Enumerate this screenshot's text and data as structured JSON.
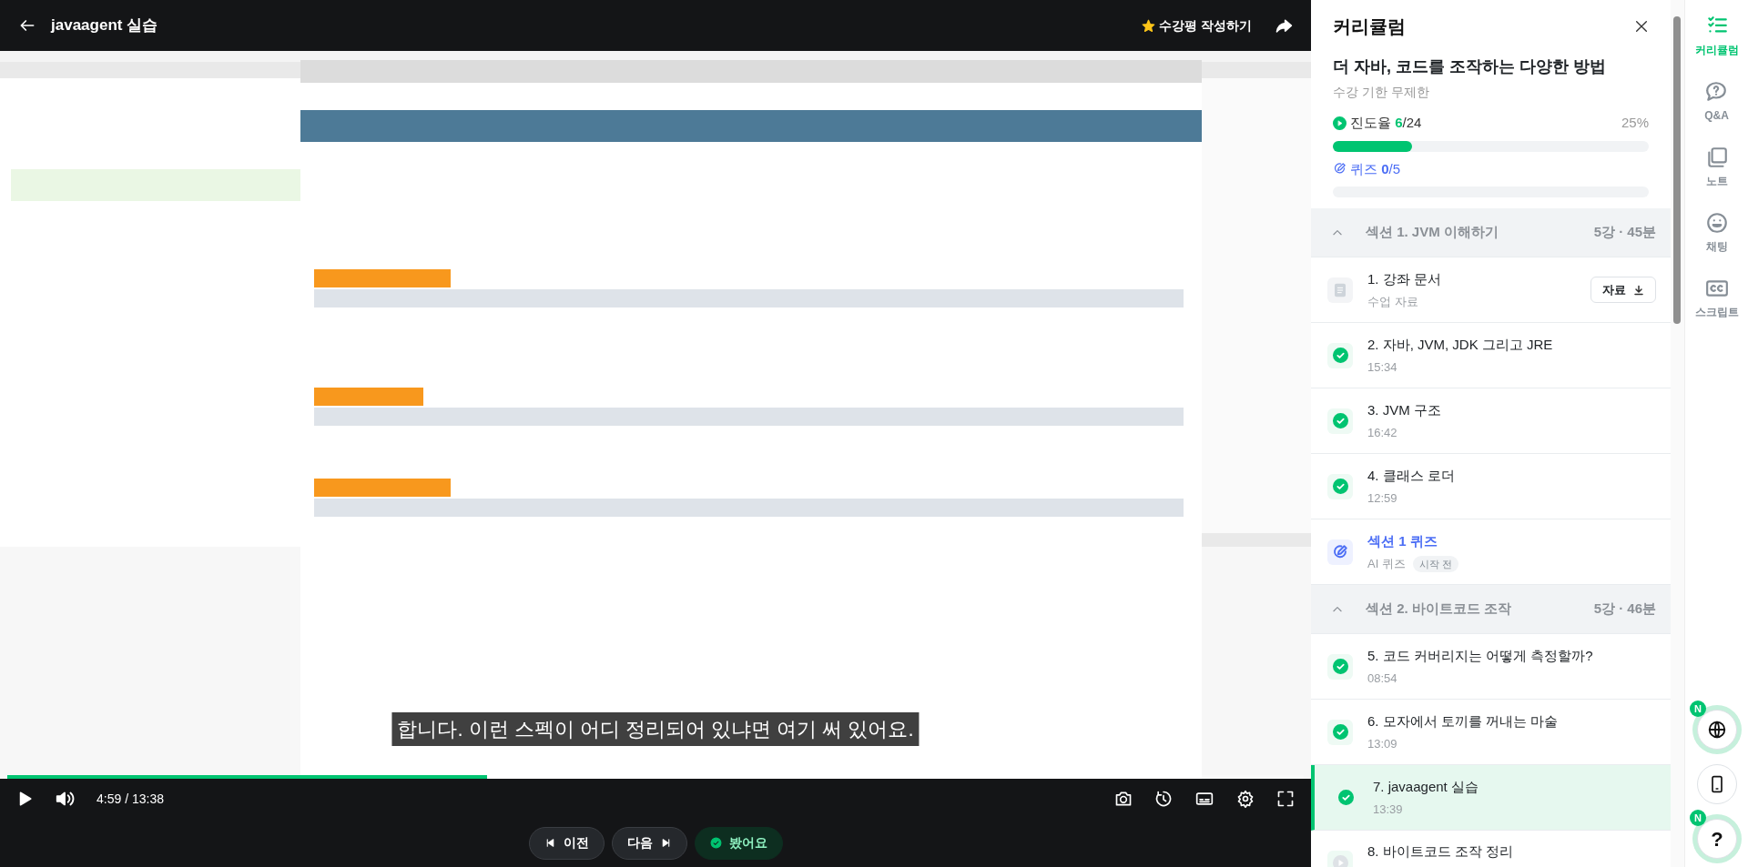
{
  "header": {
    "title": "javaagent 실습",
    "review_button": "수강평 작성하기"
  },
  "video": {
    "kind": "picture",
    "caption": "합니다. 이런 스펙이 어디 정리되어 있냐면 여기 써 있어요.",
    "level": 0.37
  },
  "controls": {
    "time": "4:59 / 13:38"
  },
  "nav_buttons": [
    {
      "kind": "prev",
      "label": "이전"
    },
    {
      "kind": "next",
      "label": "다음"
    },
    {
      "kind": "watched",
      "label": "봤어요"
    }
  ],
  "curriculum": {
    "title": "커리큘럼",
    "course_title": "더 자바, 코드를 조작하는 다양한 방법",
    "period": "수강 기한 무제한",
    "progress": {
      "label": "진도율",
      "count": "**6**/24",
      "percent": "25%",
      "level": 0.25
    },
    "quiz": {
      "label": "퀴즈",
      "count": "**0**/5",
      "level": 0
    },
    "sections": [
      {
        "title": "섹션 1. JVM 이해하기",
        "meta": "5강 · 45분",
        "expanded": true,
        "items": [
          {
            "kind": "doc",
            "title": "1. 강좌 문서",
            "subtitle": "수업 자료",
            "button": "자료",
            "selected": false
          },
          {
            "kind": "lesson",
            "title": "2. 자바, JVM, JDK 그리고 JRE",
            "subtitle": "15:34",
            "completed": true,
            "selected": false
          },
          {
            "kind": "lesson",
            "title": "3. JVM 구조",
            "subtitle": "16:42",
            "completed": true,
            "selected": false
          },
          {
            "kind": "lesson",
            "title": "4. 클래스 로더",
            "subtitle": "12:59",
            "completed": true,
            "selected": false
          },
          {
            "kind": "quiz",
            "title": "섹션 1 퀴즈",
            "subtitle": "AI 퀴즈",
            "tag": "시작 전",
            "selected": false
          }
        ]
      },
      {
        "title": "섹션 2. 바이트코드 조작",
        "meta": "5강 · 46분",
        "expanded": true,
        "items": [
          {
            "kind": "lesson",
            "title": "5. 코드 커버리지는 어떻게 측정할까?",
            "subtitle": "08:54",
            "completed": true,
            "selected": false
          },
          {
            "kind": "lesson",
            "title": "6. 모자에서 토끼를 꺼내는 마술",
            "subtitle": "13:09",
            "completed": true,
            "selected": false
          },
          {
            "kind": "lesson",
            "title": "7. javaagent 실습",
            "subtitle": "13:39",
            "completed": true,
            "selected": true
          },
          {
            "kind": "lesson",
            "title": "8. 바이트코드 조작 정리",
            "completed": false,
            "selected": false
          }
        ]
      }
    ]
  },
  "rail": [
    {
      "kind": "curriculum",
      "label": "커리큘럼",
      "selected": true
    },
    {
      "kind": "qna",
      "label": "Q&A",
      "selected": false
    },
    {
      "kind": "note",
      "label": "노트",
      "selected": false
    },
    {
      "kind": "chat",
      "label": "채팅",
      "selected": false
    },
    {
      "kind": "script",
      "label": "스크립트",
      "selected": false
    }
  ],
  "floating": [
    {
      "kind": "globe",
      "badge": "N"
    },
    {
      "kind": "phone"
    },
    {
      "kind": "help",
      "label": "?",
      "badge": "N"
    }
  ]
}
